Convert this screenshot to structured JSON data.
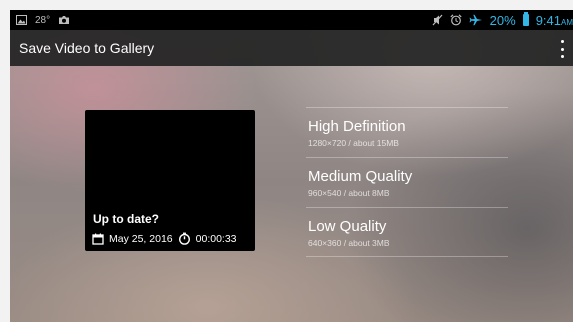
{
  "status_bar": {
    "temperature": "28°",
    "battery_percent": "20%",
    "time": "9:41",
    "time_suffix": "AM",
    "icons": [
      "image-icon",
      "camera-icon",
      "mute-icon",
      "alarm-icon",
      "airplane-icon",
      "battery-icon"
    ]
  },
  "action_bar": {
    "title": "Save Video to Gallery",
    "overflow_icon": "more-vertical-icon"
  },
  "video_card": {
    "title": "Up to date?",
    "date": "May 25, 2016",
    "duration": "00:00:33",
    "icons": [
      "calendar-icon",
      "stopwatch-icon"
    ]
  },
  "quality_options": [
    {
      "label": "High Definition",
      "detail": "1280×720 / about 15MB"
    },
    {
      "label": "Medium Quality",
      "detail": "960×540 / about 8MB"
    },
    {
      "label": "Low Quality",
      "detail": "640×360 / about 3MB"
    }
  ],
  "colors": {
    "accent": "#33b5e5",
    "status_bar": "#000000",
    "action_bar": "#232323",
    "card": "#000000"
  }
}
